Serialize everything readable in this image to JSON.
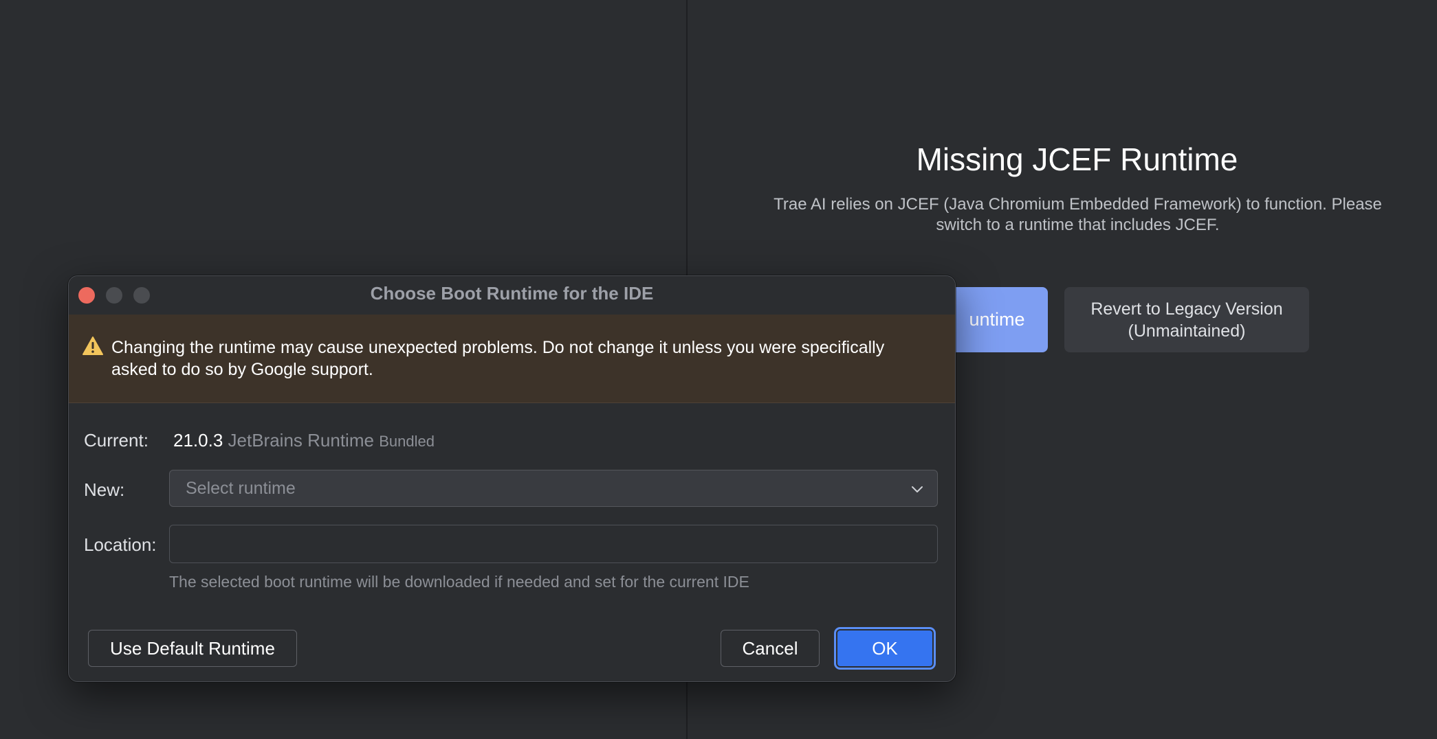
{
  "background": {
    "panel_title": "Missing JCEF Runtime",
    "panel_description": "Trae AI relies on JCEF (Java Chromium Embedded Framework) to function. Please switch to a runtime that includes JCEF.",
    "switch_button_label": "untime",
    "revert_button_label": "Revert to Legacy Version (Unmaintained)",
    "accent_color": "#7e9ef2"
  },
  "dialog": {
    "title": "Choose Boot Runtime for the IDE",
    "warning": "Changing the runtime may cause unexpected problems. Do not change it unless you were specifically asked to do so by Google support.",
    "current_label": "Current:",
    "current_version": "21.0.3",
    "current_runtime_name": "JetBrains Runtime",
    "current_runtime_tag": "Bundled",
    "new_label": "New:",
    "new_placeholder": "Select runtime",
    "location_label": "Location:",
    "location_value": "",
    "hint": "The selected boot runtime will be downloaded if needed and set for the current IDE",
    "default_button_label": "Use Default Runtime",
    "cancel_button_label": "Cancel",
    "ok_button_label": "OK",
    "ok_color": "#3574f0",
    "warning_icon": "warning-triangle-icon"
  }
}
